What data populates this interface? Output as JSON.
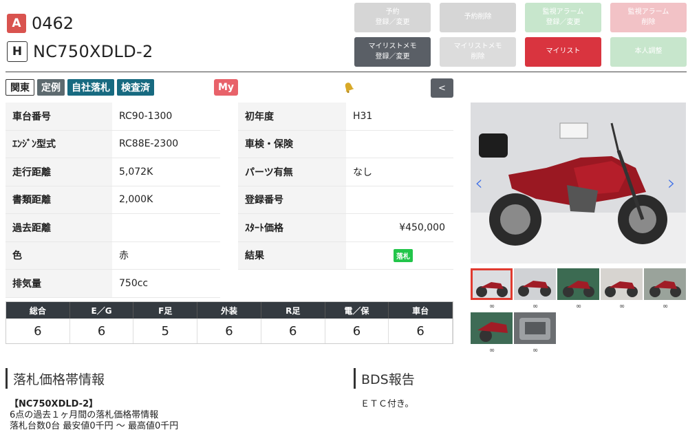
{
  "header": {
    "grade_badge": "A",
    "lot_number": "0462",
    "maker_badge": "H",
    "model": "NC750XDLD-2"
  },
  "actions": [
    {
      "label": "予約\n登録／変更",
      "style": "g1"
    },
    {
      "label": "予約削除",
      "style": "g1"
    },
    {
      "label": "監視アラーム\n登録／変更",
      "style": "gr"
    },
    {
      "label": "監視アラーム\n削除",
      "style": "pk"
    },
    {
      "label": "マイリストメモ\n登録／変更",
      "style": "gd"
    },
    {
      "label": "マイリストメモ\n削除",
      "style": "g2"
    },
    {
      "label": "マイリスト",
      "style": "rd"
    },
    {
      "label": "本人調整",
      "style": "gr"
    }
  ],
  "tags": [
    "関東",
    "定例",
    "自社落札",
    "検査済"
  ],
  "my_tag": "My",
  "back_label": "<",
  "spec_left": [
    {
      "key": "車台番号",
      "value": "RC90-1300"
    },
    {
      "key": "ｴﾝｼﾞﾝ型式",
      "value": "RC88E-2300"
    },
    {
      "key": "走行距離",
      "value": "5,072K"
    },
    {
      "key": "書類距離",
      "value": "2,000K"
    },
    {
      "key": "過去距離",
      "value": ""
    },
    {
      "key": "色",
      "value": "赤"
    },
    {
      "key": "排気量",
      "value": "750cc"
    }
  ],
  "spec_right": [
    {
      "key": "初年度",
      "value": "H31"
    },
    {
      "key": "車検・保険",
      "value": ""
    },
    {
      "key": "パーツ有無",
      "value": "なし"
    },
    {
      "key": "登録番号",
      "value": ""
    },
    {
      "key": "ｽﾀｰﾄ価格",
      "value": "¥450,000"
    },
    {
      "key": "結果",
      "value": "落札"
    }
  ],
  "scores": {
    "headers": [
      "総合",
      "E／G",
      "F足",
      "外装",
      "R足",
      "電／保",
      "車台"
    ],
    "values": [
      "6",
      "6",
      "5",
      "6",
      "6",
      "6",
      "6"
    ]
  },
  "price_section": {
    "title": "落札価格帯情報",
    "model_line": "【NC750XDLD-2】",
    "line1": "6点の過去１ヶ月間の落札価格帯情報",
    "line2": "落札台数0台 最安値0千円 〜 最高値0千円"
  },
  "report_section": {
    "title": "BDS報告",
    "text": "ＥＴＣ付き。"
  },
  "colors": {
    "accent_red": "#d9343f",
    "teal": "#176a80",
    "score_header": "#343a40",
    "result_green": "#22c54a"
  },
  "icons": {
    "bell": "bell-icon",
    "link": "link-icon",
    "prev": "chevron-left-icon",
    "next": "chevron-right-icon"
  }
}
